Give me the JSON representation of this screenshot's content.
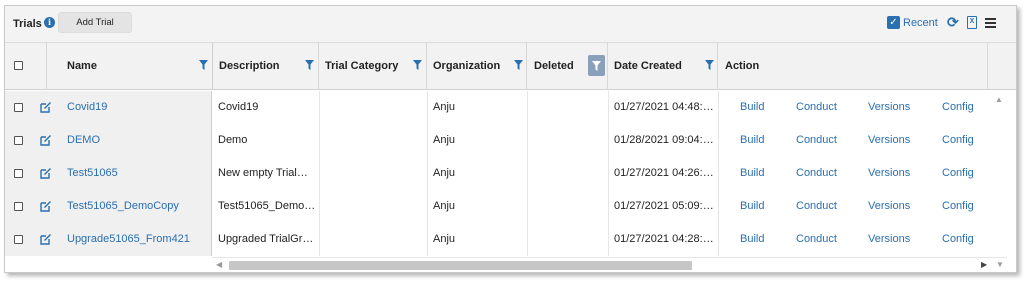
{
  "toolbar": {
    "title": "Trials",
    "info_glyph": "i",
    "add_button": "Add Trial",
    "recent_label": "Recent",
    "check_glyph": "✓",
    "refresh_glyph": "⟳",
    "export_glyph": "X"
  },
  "columns": [
    {
      "key": "name",
      "label": "Name"
    },
    {
      "key": "description",
      "label": "Description"
    },
    {
      "key": "category",
      "label": "Trial Category"
    },
    {
      "key": "organization",
      "label": "Organization"
    },
    {
      "key": "deleted",
      "label": "Deleted"
    },
    {
      "key": "date_created",
      "label": "Date Created"
    },
    {
      "key": "action",
      "label": "Action"
    }
  ],
  "rows": [
    {
      "name": "Covid19",
      "description": "Covid19",
      "category": "",
      "organization": "Anju",
      "deleted": "",
      "date_created": "01/27/2021 04:48:…",
      "actions": [
        "Build",
        "Conduct",
        "Versions",
        "Config"
      ]
    },
    {
      "name": "DEMO",
      "description": "Demo",
      "category": "",
      "organization": "Anju",
      "deleted": "",
      "date_created": "01/28/2021 09:04:…",
      "actions": [
        "Build",
        "Conduct",
        "Versions",
        "Config"
      ]
    },
    {
      "name": "Test51065",
      "description": "New empty Trial…",
      "category": "",
      "organization": "Anju",
      "deleted": "",
      "date_created": "01/27/2021 04:26:…",
      "actions": [
        "Build",
        "Conduct",
        "Versions",
        "Config"
      ]
    },
    {
      "name": "Test51065_DemoCopy",
      "description": "Test51065_Demo…",
      "category": "",
      "organization": "Anju",
      "deleted": "",
      "date_created": "01/27/2021 05:09:…",
      "actions": [
        "Build",
        "Conduct",
        "Versions",
        "Config"
      ]
    },
    {
      "name": "Upgrade51065_From421",
      "description": "Upgraded TrialGr…",
      "category": "",
      "organization": "Anju",
      "deleted": "",
      "date_created": "01/27/2021 04:28:…",
      "actions": [
        "Build",
        "Conduct",
        "Versions",
        "Config"
      ]
    }
  ],
  "colors": {
    "link": "#2a6fb0",
    "filter_active": "#8a9fba",
    "header_bg": "#f2f2f2"
  }
}
